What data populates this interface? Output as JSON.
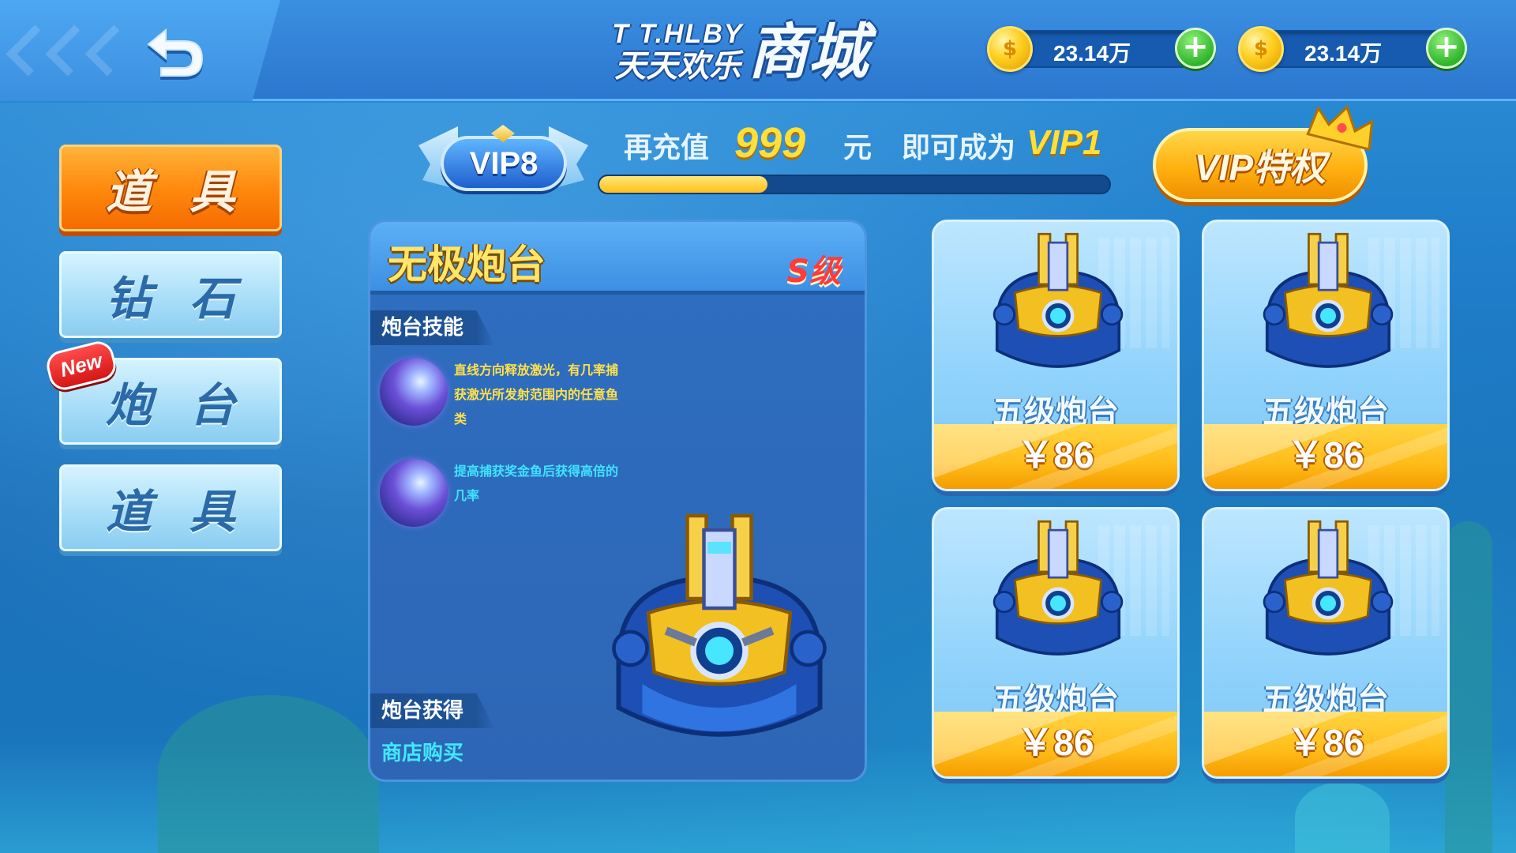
{
  "header": {
    "logo_latin": "T T.HLBY",
    "logo_cn": "天天欢乐",
    "logo_big": "商城",
    "currencies": [
      {
        "value": "23.14万",
        "icon": "gold-coin-icon",
        "plus_label": "+"
      },
      {
        "value": "23.14万",
        "icon": "gold-coin-icon",
        "plus_label": "+"
      }
    ],
    "back_icon": "back-arrow-icon"
  },
  "sidebar": {
    "items": [
      {
        "label": "道具",
        "active": true
      },
      {
        "label": "钻石",
        "active": false
      },
      {
        "label": "炮台",
        "active": false,
        "badge": "New"
      },
      {
        "label": "道具",
        "active": false
      }
    ]
  },
  "vip": {
    "current_level": "VIP8",
    "text_prefix": "再充值",
    "amount": "999",
    "unit": "元",
    "text_suffix": "即可成为",
    "next_level": "VIP1",
    "progress": 0.33,
    "button_label": "VIP特权"
  },
  "detail": {
    "title": "无极炮台",
    "grade": "S级",
    "skills_header": "炮台技能",
    "skills": [
      {
        "text": "直线方向释放激光，有几率捕获激光所发射范围内的任意鱼类",
        "color": "#ffe14a"
      },
      {
        "text": "提高捕获奖金鱼后获得高倍的几率",
        "color": "#3fe4ff"
      }
    ],
    "obtain_header": "炮台获得",
    "obtain_method": "商店购买"
  },
  "products": [
    {
      "name": "五级炮台",
      "price": "￥86"
    },
    {
      "name": "五级炮台",
      "price": "￥86"
    },
    {
      "name": "五级炮台",
      "price": "￥86"
    },
    {
      "name": "五级炮台",
      "price": "￥86"
    }
  ]
}
